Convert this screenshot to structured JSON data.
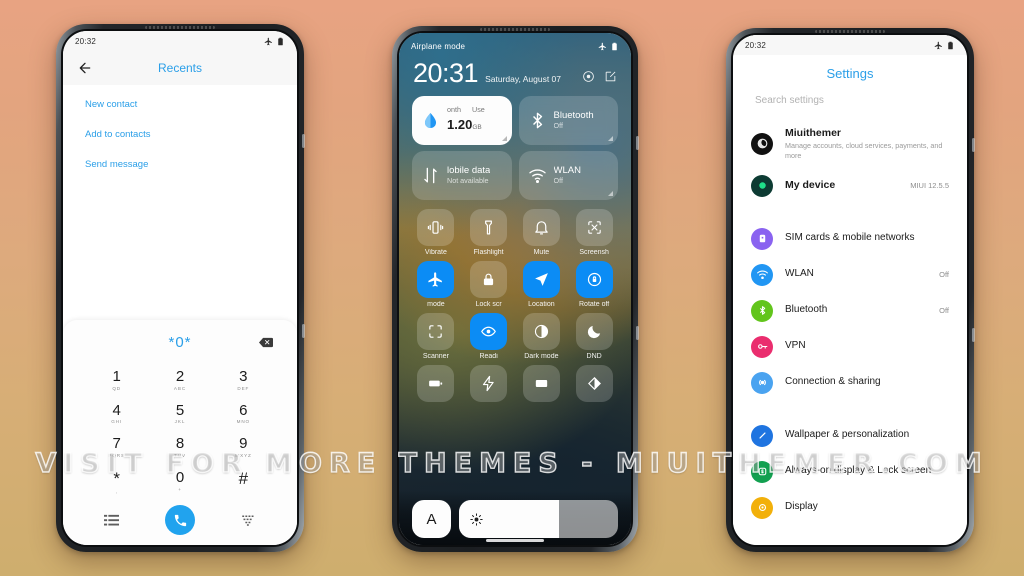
{
  "background": {
    "top_color": "#e8a382",
    "bottom_color": "#ceae6e"
  },
  "watermark": {
    "text": "VISIT FOR MORE THEMES - MIUITHEMER.COM"
  },
  "phone1": {
    "status_bar": {
      "time": "20:32",
      "icons": [
        "airplane-icon",
        "battery-icon"
      ]
    },
    "appbar": {
      "back_icon": "arrow-left-icon",
      "title": "Recents"
    },
    "links": [
      "New contact",
      "Add to contacts",
      "Send message"
    ],
    "dialpad": {
      "number": "*0*",
      "delete_icon": "backspace-icon",
      "keys": [
        {
          "digit": "1",
          "letters": "QD"
        },
        {
          "digit": "2",
          "letters": "ABC"
        },
        {
          "digit": "3",
          "letters": "DEF"
        },
        {
          "digit": "4",
          "letters": "GHI"
        },
        {
          "digit": "5",
          "letters": "JKL"
        },
        {
          "digit": "6",
          "letters": "MNO"
        },
        {
          "digit": "7",
          "letters": "PQRS"
        },
        {
          "digit": "8",
          "letters": "TUV"
        },
        {
          "digit": "9",
          "letters": "WXYZ"
        },
        {
          "digit": "*",
          "letters": ","
        },
        {
          "digit": "0",
          "letters": "+"
        },
        {
          "digit": "#",
          "letters": ""
        }
      ],
      "nav": {
        "left_icon": "call-log-icon",
        "call_icon": "phone-icon",
        "right_icon": "keypad-icon"
      },
      "accent": "#21a3ee"
    }
  },
  "phone2": {
    "status_bar": {
      "label": "Airplane mode",
      "icons": [
        "airplane-icon",
        "battery-icon"
      ]
    },
    "clock": {
      "time": "20:31",
      "date": "Saturday, August 07"
    },
    "header_actions": [
      "settings-gear-icon",
      "edit-icon"
    ],
    "big_tiles": [
      {
        "icon": "data-drop-icon",
        "label_left": "onth",
        "label_right": "Use",
        "value": "1.20",
        "unit": "GB",
        "style": "white"
      },
      {
        "icon": "bluetooth-icon",
        "title": "Bluetooth",
        "subtitle": "Off",
        "style": "frosted"
      },
      {
        "icon": "mobile-data-icon",
        "title": "lobile data",
        "subtitle": "Not available",
        "style": "frosted"
      },
      {
        "icon": "wifi-icon",
        "title": "WLAN",
        "subtitle": "Off",
        "style": "frosted"
      }
    ],
    "toggles": [
      {
        "label": "Vibrate",
        "icon": "vibrate-icon",
        "on": false
      },
      {
        "label": "Flashlight",
        "icon": "flashlight-icon",
        "on": false
      },
      {
        "label": "Mute",
        "icon": "bell-icon",
        "on": false
      },
      {
        "label": "Screensh",
        "icon": "screenshot-icon",
        "on": false
      },
      {
        "label": "mode",
        "icon": "airplane-icon",
        "on": true
      },
      {
        "label": "Lock scr",
        "icon": "lock-icon",
        "on": false
      },
      {
        "label": "Location",
        "icon": "location-arrow-icon",
        "on": true
      },
      {
        "label": "Rotate off",
        "icon": "rotate-lock-icon",
        "on": true
      },
      {
        "label": "Scanner",
        "icon": "scanner-icon",
        "on": false
      },
      {
        "label": "Readi",
        "icon": "eye-icon",
        "on": true
      },
      {
        "label": "Dark mode",
        "icon": "contrast-icon",
        "on": false
      },
      {
        "label": "DND",
        "icon": "moon-icon",
        "on": false
      },
      {
        "label": "",
        "icon": "battery-saver-icon",
        "on": false
      },
      {
        "label": "",
        "icon": "lightning-icon",
        "on": false
      },
      {
        "label": "",
        "icon": "cast-icon",
        "on": false
      },
      {
        "label": "",
        "icon": "theme-icon",
        "on": false
      }
    ],
    "brightness": {
      "auto_label": "A",
      "sun_icon": "sun-icon",
      "level_percent": 63
    },
    "accent_on": "#0b8cf5"
  },
  "phone3": {
    "status_bar": {
      "time": "20:32",
      "icons": [
        "airplane-icon",
        "battery-icon"
      ]
    },
    "title": "Settings",
    "search_placeholder": "Search settings",
    "account": {
      "name": "Miuithemer",
      "subtitle": "Manage accounts, cloud services, payments, and more",
      "icon": "account-avatar-icon",
      "color": "#111111"
    },
    "device": {
      "name": "My device",
      "value": "MIUI 12.5.5",
      "icon": "device-icon",
      "color": "#0d3b33"
    },
    "items": [
      {
        "name": "SIM cards & mobile networks",
        "value": "",
        "icon": "sim-card-icon",
        "color": "#8a63f0"
      },
      {
        "name": "WLAN",
        "value": "Off",
        "icon": "wifi-icon",
        "color": "#2196f3"
      },
      {
        "name": "Bluetooth",
        "value": "Off",
        "icon": "bluetooth-icon",
        "color": "#62c51c"
      },
      {
        "name": "VPN",
        "value": "",
        "icon": "vpn-key-icon",
        "color": "#ea2d6e"
      },
      {
        "name": "Connection & sharing",
        "value": "",
        "icon": "share-icon",
        "color": "#4aa3f0"
      }
    ],
    "items2": [
      {
        "name": "Wallpaper & personalization",
        "value": "",
        "icon": "brush-icon",
        "color": "#1f74e0"
      },
      {
        "name": "Always-on display & Lock screen",
        "value": "",
        "icon": "lock-screen-icon",
        "color": "#12a050"
      },
      {
        "name": "Display",
        "value": "",
        "icon": "display-gear-icon",
        "color": "#f2b00a"
      }
    ],
    "accent": "#2b9fe8"
  }
}
